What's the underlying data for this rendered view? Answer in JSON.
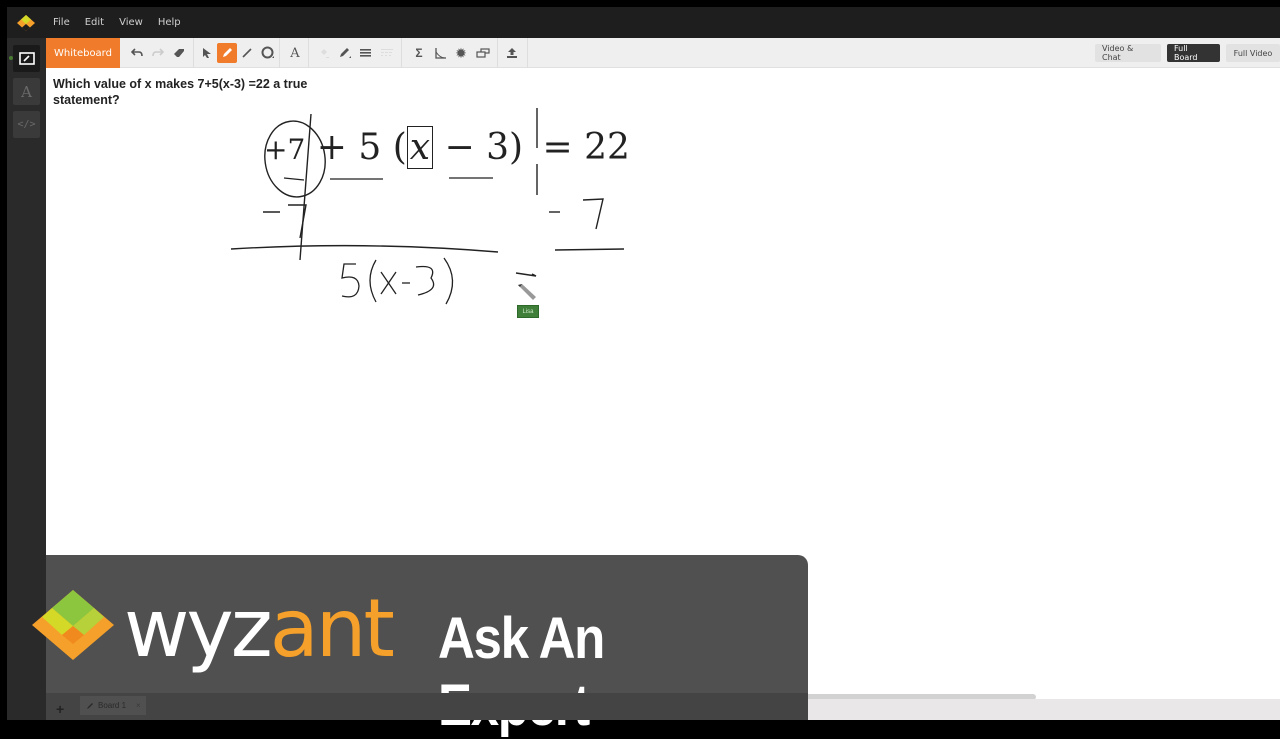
{
  "menu": {
    "items": [
      "File",
      "Edit",
      "View",
      "Help"
    ]
  },
  "leftbar": {
    "items": [
      {
        "icon": "whiteboard-icon",
        "active": true
      },
      {
        "icon": "text-editor-icon",
        "glyph": "A",
        "active": false
      },
      {
        "icon": "code-editor-icon",
        "glyph": "</>",
        "active": false
      }
    ]
  },
  "toolbar": {
    "active_tab": "Whiteboard",
    "tools": [
      "undo",
      "redo",
      "eraser",
      "select",
      "pen",
      "line",
      "shape",
      "text",
      "fill",
      "color",
      "stroke-width",
      "line-style",
      "equation",
      "graph",
      "settings",
      "layers",
      "upload"
    ],
    "active_tool": "pen"
  },
  "view_modes": {
    "video_chat": "Video & Chat",
    "full_board": "Full Board",
    "full_video": "Full Video",
    "active": "Full Board"
  },
  "board": {
    "question": "Which value of x makes 7+5(x-3) =22 a true statement?",
    "typeset_equation": {
      "t1": "+7",
      "t2": "+ 5",
      "open": "(",
      "x": "x",
      "minus3": "− 3",
      "close": ")",
      "eq": "=",
      "rhs": "22"
    },
    "handwritten": {
      "left_sub": "−7",
      "right_sub": "- 7",
      "result": "5(x-3)"
    },
    "cursor_user": "Lisa"
  },
  "bottom": {
    "add_label": "+",
    "board_tab": "Board 1",
    "close": "×"
  },
  "branding": {
    "wyz": "wyz",
    "ant": "ant",
    "tagline": "Ask An Expert",
    "colors": {
      "orange": "#f5a02a",
      "green": "#8cc63f",
      "yellow": "#d4d827"
    }
  },
  "accent": "#f07b2a"
}
